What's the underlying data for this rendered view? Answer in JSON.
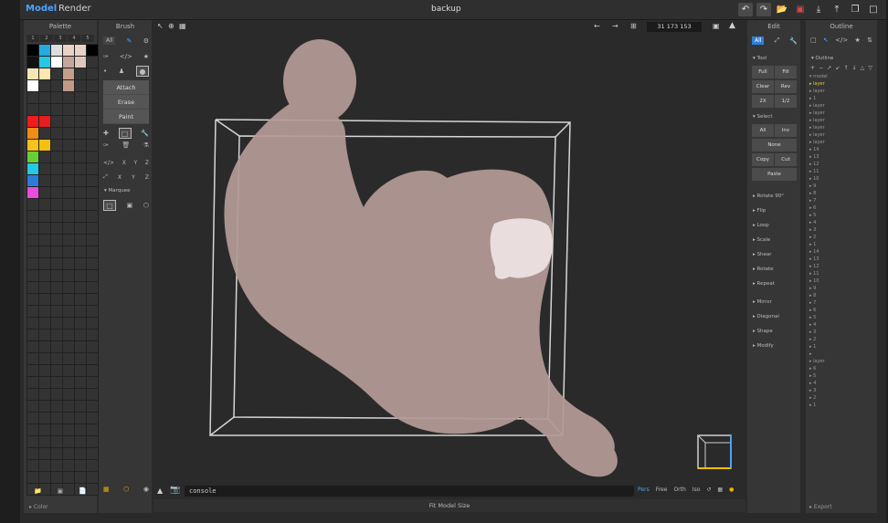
{
  "app": {
    "mode_model": "Model",
    "mode_render": "Render",
    "file_title": "backup"
  },
  "palette": {
    "header": "Palette",
    "tabs": [
      "1",
      "2",
      "3",
      "4",
      "5"
    ],
    "footer_label": "Color",
    "colors": [
      "#000000",
      "#28a9e0",
      "#dddddd",
      "#e9d3c7",
      "#e9d3c7",
      "#000000",
      "#111111",
      "#26c8e8",
      "#ffffff",
      "#c4a79a",
      "#e0c7bb",
      "#333333",
      "#f6e6b4",
      "#ffe7b0",
      "#333333",
      "#c49e88",
      "#333333",
      "#333333",
      "#ffffff",
      "#333333",
      "#333333",
      "#c09a86",
      "#333333",
      "#333333",
      "#333333",
      "#333333",
      "#333333",
      "#333333",
      "#333333",
      "#333333",
      "#333333",
      "#333333",
      "#333333",
      "#333333",
      "#333333",
      "#333333",
      "#ee1c1c",
      "#e71e1e",
      "#333333",
      "#333333",
      "#333333",
      "#333333",
      "#f08c18",
      "#333333",
      "#333333",
      "#333333",
      "#333333",
      "#333333",
      "#f7c21a",
      "#f3c114",
      "#333333",
      "#333333",
      "#333333",
      "#333333",
      "#69cf36",
      "#333333",
      "#333333",
      "#333333",
      "#333333",
      "#333333",
      "#26c8e8",
      "#333333",
      "#333333",
      "#333333",
      "#333333",
      "#333333",
      "#2e7cd8",
      "#333333",
      "#333333",
      "#333333",
      "#333333",
      "#333333",
      "#ea4cdd",
      "#333333",
      "#333333",
      "#333333",
      "#333333",
      "#333333"
    ]
  },
  "brush": {
    "header": "Brush",
    "all_label": "All",
    "attach": "Attach",
    "erase": "Erase",
    "paint": "Paint",
    "mirror_labels": [
      "X",
      "Y",
      "Z"
    ],
    "marquee_label": "Marquee"
  },
  "viewport": {
    "coords": "31 173 153",
    "console_text": "console",
    "views": [
      "Pers",
      "Free",
      "Orth",
      "Iso"
    ],
    "active_view": "Pers",
    "fit_label": "Fit Model Size"
  },
  "edit": {
    "header": "Edit",
    "all_label": "All",
    "tool_section": "Tool",
    "tool_buttons": [
      "Full",
      "Fill",
      "Clear",
      "Rev",
      "2X",
      "1/2"
    ],
    "select_section": "Select",
    "select_buttons": [
      "All",
      "Inv"
    ],
    "none_label": "None",
    "copy_label": "Copy",
    "cut_label": "Cut",
    "paste_label": "Paste",
    "menu_items": [
      "Rotate 90°",
      "Flip",
      "Loop",
      "Scale",
      "Shear",
      "Rotate",
      "Repeat",
      "Mirror",
      "Diagonal",
      "Shape",
      "Modify"
    ]
  },
  "outline": {
    "header": "Outline",
    "section_label": "Outline",
    "items": [
      "model",
      "layer",
      "layer",
      "1",
      "layer",
      "layer",
      "layer",
      "layer",
      "layer",
      "layer",
      "14",
      "13",
      "12",
      "11",
      "10",
      "9",
      "8",
      "7",
      "6",
      "5",
      "4",
      "3",
      "2",
      "1",
      "14",
      "13",
      "12",
      "11",
      "10",
      "9",
      "8",
      "7",
      "6",
      "5",
      "4",
      "3",
      "2",
      "1",
      "",
      "layer",
      "6",
      "5",
      "4",
      "3",
      "2",
      "1"
    ],
    "highlight_index": 1,
    "export_label": "Export"
  }
}
